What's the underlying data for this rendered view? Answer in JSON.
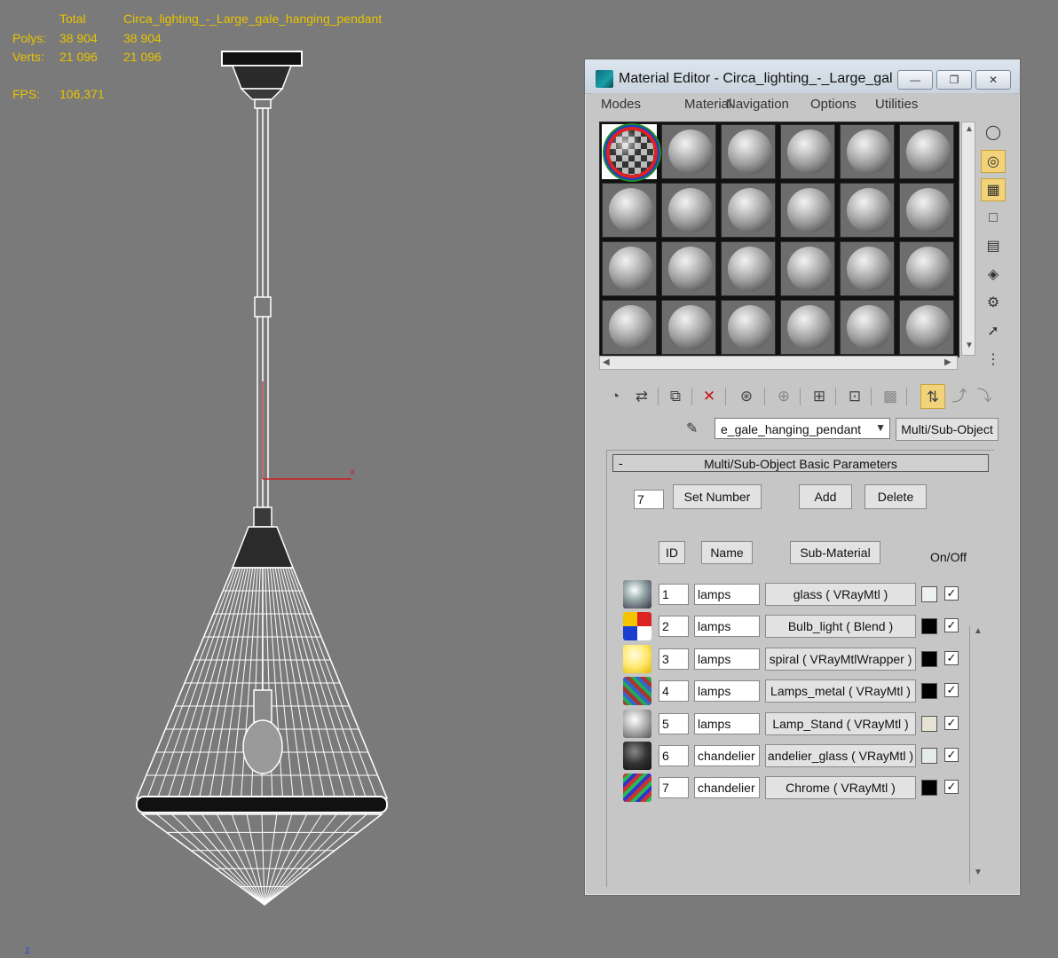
{
  "stats": {
    "total_label": "Total",
    "object_name": "Circa_lighting_-_Large_gale_hanging_pendant",
    "polys_label": "Polys:",
    "polys_total": "38 904",
    "polys_object": "38 904",
    "verts_label": "Verts:",
    "verts_total": "21 096",
    "verts_object": "21 096",
    "fps_label": "FPS:",
    "fps_value": "106,371"
  },
  "viewport": {
    "axis_x_label": "x",
    "axis_z_label": "z"
  },
  "window": {
    "title": "Material Editor - Circa_lighting_-_Large_gal...",
    "minimize": "—",
    "restore": "❐",
    "close": "✕",
    "menu": [
      "Modes",
      "Material",
      "Navigation",
      "Options",
      "Utilities"
    ]
  },
  "toolbar": {
    "material_name": "e_gale_hanging_pendant",
    "material_type": "Multi/Sub-Object"
  },
  "panel": {
    "title": "Multi/Sub-Object Basic Parameters",
    "collapse": "-",
    "count": "7",
    "set_number": "Set Number",
    "add": "Add",
    "delete": "Delete",
    "col_id": "ID",
    "col_name": "Name",
    "col_sub": "Sub-Material",
    "col_onoff": "On/Off"
  },
  "submaterials": [
    {
      "id": "1",
      "name": "lamps",
      "sub": "glass  ( VRayMtl )",
      "swatch": "#eef2ef",
      "on": "✓"
    },
    {
      "id": "2",
      "name": "lamps",
      "sub": "Bulb_light  ( Blend )",
      "swatch": "#000000",
      "on": "✓"
    },
    {
      "id": "3",
      "name": "lamps",
      "sub": "spiral  ( VRayMtlWrapper )",
      "swatch": "#000000",
      "on": "✓"
    },
    {
      "id": "4",
      "name": "lamps",
      "sub": "Lamps_metal  ( VRayMtl )",
      "swatch": "#000000",
      "on": "✓"
    },
    {
      "id": "5",
      "name": "lamps",
      "sub": "Lamp_Stand  ( VRayMtl )",
      "swatch": "#e8e2d6",
      "on": "✓"
    },
    {
      "id": "6",
      "name": "chandelier",
      "sub": "andelier_glass  ( VRayMtl )",
      "swatch": "#e4ece8",
      "on": "✓"
    },
    {
      "id": "7",
      "name": "chandelier",
      "sub": "Chrome  ( VRayMtl )",
      "swatch": "#000000",
      "on": "✓"
    }
  ]
}
